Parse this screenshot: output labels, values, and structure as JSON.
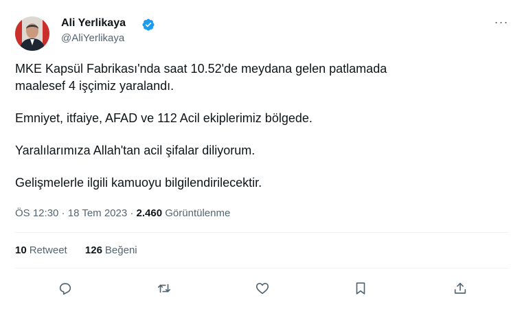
{
  "user": {
    "display_name": "Ali Yerlikaya",
    "handle": "@AliYerlikaya",
    "verified_icon": "verified-badge-icon"
  },
  "menu": {
    "more_label": "···"
  },
  "tweet": {
    "line1": "MKE Kapsül Fabrikası'nda saat 10.52'de meydana gelen patlamada",
    "line2": "maalesef 4 işçimiz yaralandı.",
    "para2": "Emniyet, itfaiye, AFAD ve 112 Acil ekiplerimiz bölgede.",
    "para3": "Yaralılarımıza Allah'tan acil şifalar diliyorum.",
    "para4": "Gelişmelerle ilgili kamuoyu bilgilendirilecektir."
  },
  "meta": {
    "time": "ÖS 12:30",
    "separator": " · ",
    "date": "18 Tem 2023",
    "views_count": "2.460",
    "views_label": "Görüntülenme"
  },
  "stats": {
    "retweets_count": "10",
    "retweets_label": "Retweet",
    "likes_count": "126",
    "likes_label": "Beğeni"
  },
  "actions": [
    "reply-icon",
    "retweet-icon",
    "like-icon",
    "bookmark-icon",
    "share-icon"
  ],
  "colors": {
    "text": "#0f1419",
    "secondary": "#536471",
    "verified": "#1d9bf0",
    "divider": "#eff3f4"
  }
}
